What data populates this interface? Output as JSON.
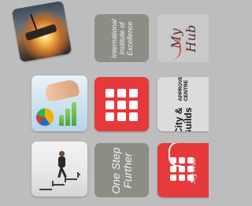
{
  "tiles": {
    "international": {
      "label": "International\nInstitute of\nExcellence"
    },
    "one_step": {
      "label": "One Step\nFurther"
    },
    "my_hub": {
      "logo_text": "My Hub"
    },
    "city_guilds": {
      "brand_text": "City &\nGuilds",
      "approved_text": "APPROVED\nCENTRE"
    },
    "my_hub_red": {
      "small_label": "My Hub"
    }
  },
  "colors": {
    "background": "#bdbdbd",
    "tile_gray": "#8d8d86",
    "tile_red": "#e6393b",
    "tile_light": "#c9c9c9"
  },
  "icons": {
    "grid": "grid-icon"
  }
}
